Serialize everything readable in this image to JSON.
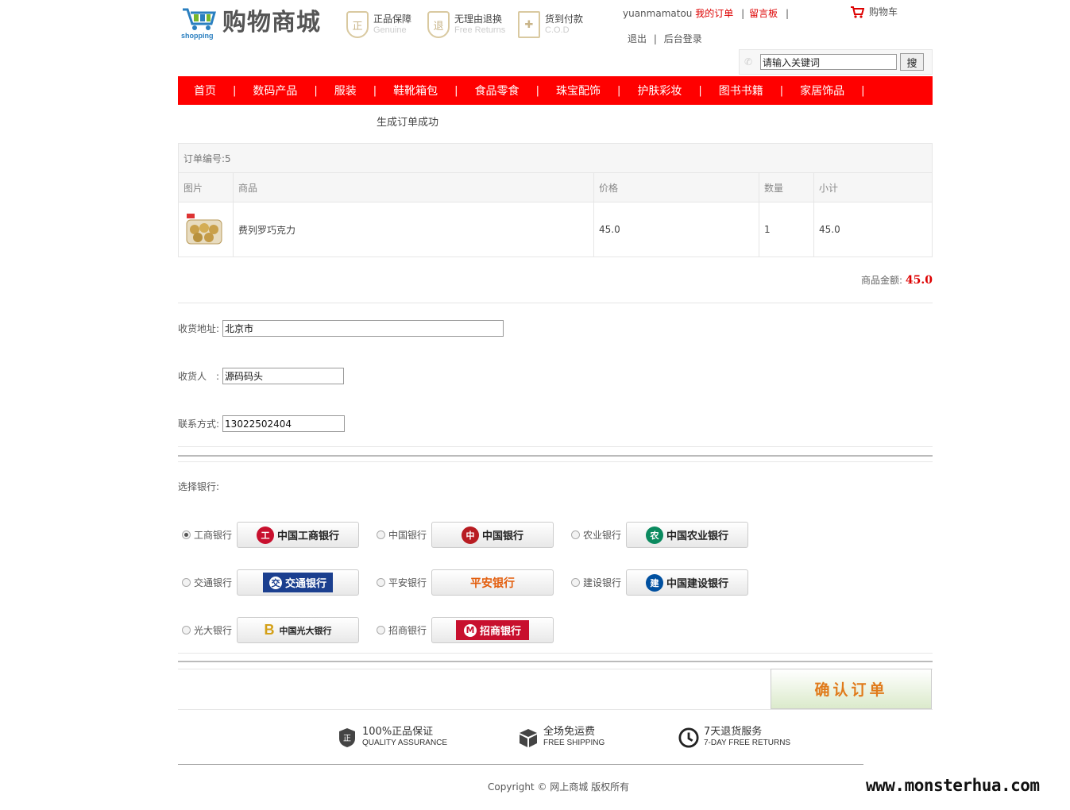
{
  "header": {
    "logo_sub": "shopping",
    "logo_title": "购物商城",
    "promises": [
      {
        "cn": "正品保障",
        "en": "Genuine",
        "icon": "shield-genuine-icon"
      },
      {
        "cn": "无理由退换",
        "en": "Free Returns",
        "icon": "shield-returns-icon"
      },
      {
        "cn": "货到付款",
        "en": "C.O.D",
        "icon": "box-cod-icon"
      }
    ],
    "user": {
      "username": "yuanmamatou",
      "my_orders": "我的订单",
      "message_board": "留言板",
      "logout": "退出",
      "admin_login": "后台登录"
    },
    "cart_label": "购物车",
    "search": {
      "value": "请输入关键词",
      "button": "搜"
    }
  },
  "nav": {
    "items": [
      "首页",
      "数码产品",
      "服装",
      "鞋靴箱包",
      "食品零食",
      "珠宝配饰",
      "护肤彩妆",
      "图书书籍",
      "家居饰品"
    ]
  },
  "order": {
    "status": "生成订单成功",
    "number_label": "订单编号:5",
    "columns": [
      "图片",
      "商品",
      "价格",
      "数量",
      "小计"
    ],
    "items": [
      {
        "name": "费列罗巧克力",
        "price": "45.0",
        "qty": "1",
        "subtotal": "45.0"
      }
    ],
    "total_label": "商品金额:",
    "total_value": "45.0"
  },
  "form": {
    "address_label": "收货地址:",
    "address_value": "北京市",
    "receiver_label": "收货人　:",
    "receiver_value": "源码码头",
    "phone_label": "联系方式:",
    "phone_value": "13022502404"
  },
  "banks": {
    "label": "选择银行:",
    "list": [
      {
        "name": "工商银行",
        "card": "中国工商银行",
        "color": "#c8102e",
        "selected": true
      },
      {
        "name": "中国银行",
        "card": "中国银行",
        "color": "#b81c22",
        "selected": false
      },
      {
        "name": "农业银行",
        "card": "中国农业银行",
        "color": "#0b8a5f",
        "selected": false
      },
      {
        "name": "交通银行",
        "card": "交通银行",
        "color": "#1b3f8f",
        "selected": false
      },
      {
        "name": "平安银行",
        "card": "平安银行",
        "color": "#e35d0c",
        "selected": false
      },
      {
        "name": "建设银行",
        "card": "中国建设银行",
        "color": "#0050a0",
        "selected": false
      },
      {
        "name": "光大银行",
        "card": "中国光大银行",
        "color": "#d4a017",
        "selected": false
      },
      {
        "name": "招商银行",
        "card": "招商银行",
        "color": "#c8102e",
        "selected": false
      }
    ]
  },
  "confirm_button": "确认订单",
  "footer": {
    "features": [
      {
        "cn": "100%正品保证",
        "en": "QUALITY ASSURANCE",
        "icon": "quality-shield-icon"
      },
      {
        "cn": "全场免运费",
        "en": "FREE SHIPPING",
        "icon": "shipping-box-icon"
      },
      {
        "cn": "7天退货服务",
        "en": "7-DAY FREE RETURNS",
        "icon": "clock-icon"
      }
    ],
    "copyright": "Copyright © 网上商城 版权所有",
    "watermark": "www.monsterhua.com"
  }
}
